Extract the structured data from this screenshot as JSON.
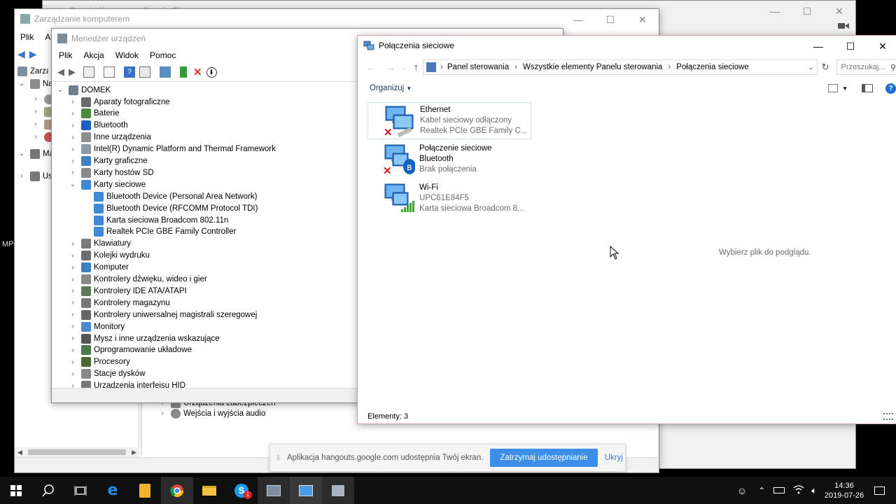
{
  "chrome_window": {
    "title": "Google Hangouts - Google Chrome"
  },
  "computer_mgmt": {
    "title": "Zarządzanie komputerem",
    "menu": [
      "Plik",
      "Akcja"
    ],
    "left_tree": [
      "Zarządzanie komputerem",
      "Narzędzia systemowe",
      "Magazyn",
      "Usługi i aplikacje"
    ],
    "lower_items": [
      "Urządzenia zabezpieczeń",
      "Wejścia i wyjścia audio"
    ]
  },
  "device_manager": {
    "title": "Menedżer urządzeń",
    "menu": [
      "Plik",
      "Akcja",
      "Widok",
      "Pomoc"
    ],
    "root": "DOMEK",
    "items": [
      {
        "label": "Aparaty fotograficzne",
        "expanded": false
      },
      {
        "label": "Baterie",
        "expanded": false
      },
      {
        "label": "Bluetooth",
        "expanded": false
      },
      {
        "label": "Inne urządzenia",
        "expanded": false
      },
      {
        "label": "Intel(R) Dynamic Platform and Thermal Framework",
        "expanded": false
      },
      {
        "label": "Karty graficzne",
        "expanded": false
      },
      {
        "label": "Karty hostów SD",
        "expanded": false
      },
      {
        "label": "Karty sieciowe",
        "expanded": true
      },
      {
        "label": "Klawiatury",
        "expanded": false
      },
      {
        "label": "Kolejki wydruku",
        "expanded": false
      },
      {
        "label": "Komputer",
        "expanded": false
      },
      {
        "label": "Kontrolery dźwięku, wideo i gier",
        "expanded": false
      },
      {
        "label": "Kontrolery IDE ATA/ATAPI",
        "expanded": false
      },
      {
        "label": "Kontrolery magazynu",
        "expanded": false
      },
      {
        "label": "Kontrolery uniwersalnej magistrali szeregowej",
        "expanded": false
      },
      {
        "label": "Monitory",
        "expanded": false
      },
      {
        "label": "Mysz i inne urządzenia wskazujące",
        "expanded": false
      },
      {
        "label": "Oprogramowanie układowe",
        "expanded": false
      },
      {
        "label": "Procesory",
        "expanded": false
      },
      {
        "label": "Stacje dysków",
        "expanded": false
      },
      {
        "label": "Urządzenia interfejsu HID",
        "expanded": false
      }
    ],
    "network_children": [
      "Bluetooth Device (Personal Area Network)",
      "Bluetooth Device (RFCOMM Protocol TDI)",
      "Karta sieciowa Broadcom 802.11n",
      "Realtek PCIe GBE Family Controller"
    ]
  },
  "network_connections": {
    "title": "Połączenia sieciowe",
    "breadcrumb": [
      "Panel sterowania",
      "Wszystkie elementy Panelu sterowania",
      "Połączenia sieciowe"
    ],
    "search_placeholder": "Przeszukaj...",
    "organize_label": "Organizuj",
    "preview_text": "Wybierz plik do podglądu.",
    "status_text": "Elementy: 3",
    "connections": [
      {
        "name": "Ethernet",
        "line2": "Kabel sieciowy odłączony",
        "line3": "Realtek PCIe GBE Family C...",
        "status": "disconnected"
      },
      {
        "name": "Połączenie sieciowe",
        "line2": "Bluetooth",
        "line3": "Brak połączenia",
        "status": "disconnected"
      },
      {
        "name": "Wi-Fi",
        "line2": "UPC61E84F5",
        "line3": "Karta sieciowa Broadcom 8...",
        "status": "connected"
      }
    ]
  },
  "share_bar": {
    "message": "Aplikacja hangouts.google.com udostępnia Twój ekran.",
    "stop_label": "Zatrzymaj udostępnianie",
    "hide_label": "Ukryj"
  },
  "taskbar": {
    "time": "14:36",
    "date": "2019-07-26",
    "apps": [
      "start-icon",
      "search-icon",
      "task-view-icon",
      "edge-icon",
      "notes-icon",
      "chrome-icon",
      "explorer-icon",
      "skype-icon",
      "device-manager-icon",
      "network-icon",
      "computer-mgmt-icon"
    ]
  },
  "left_edge_text": "MP",
  "accent_color": "#3c8ee6"
}
